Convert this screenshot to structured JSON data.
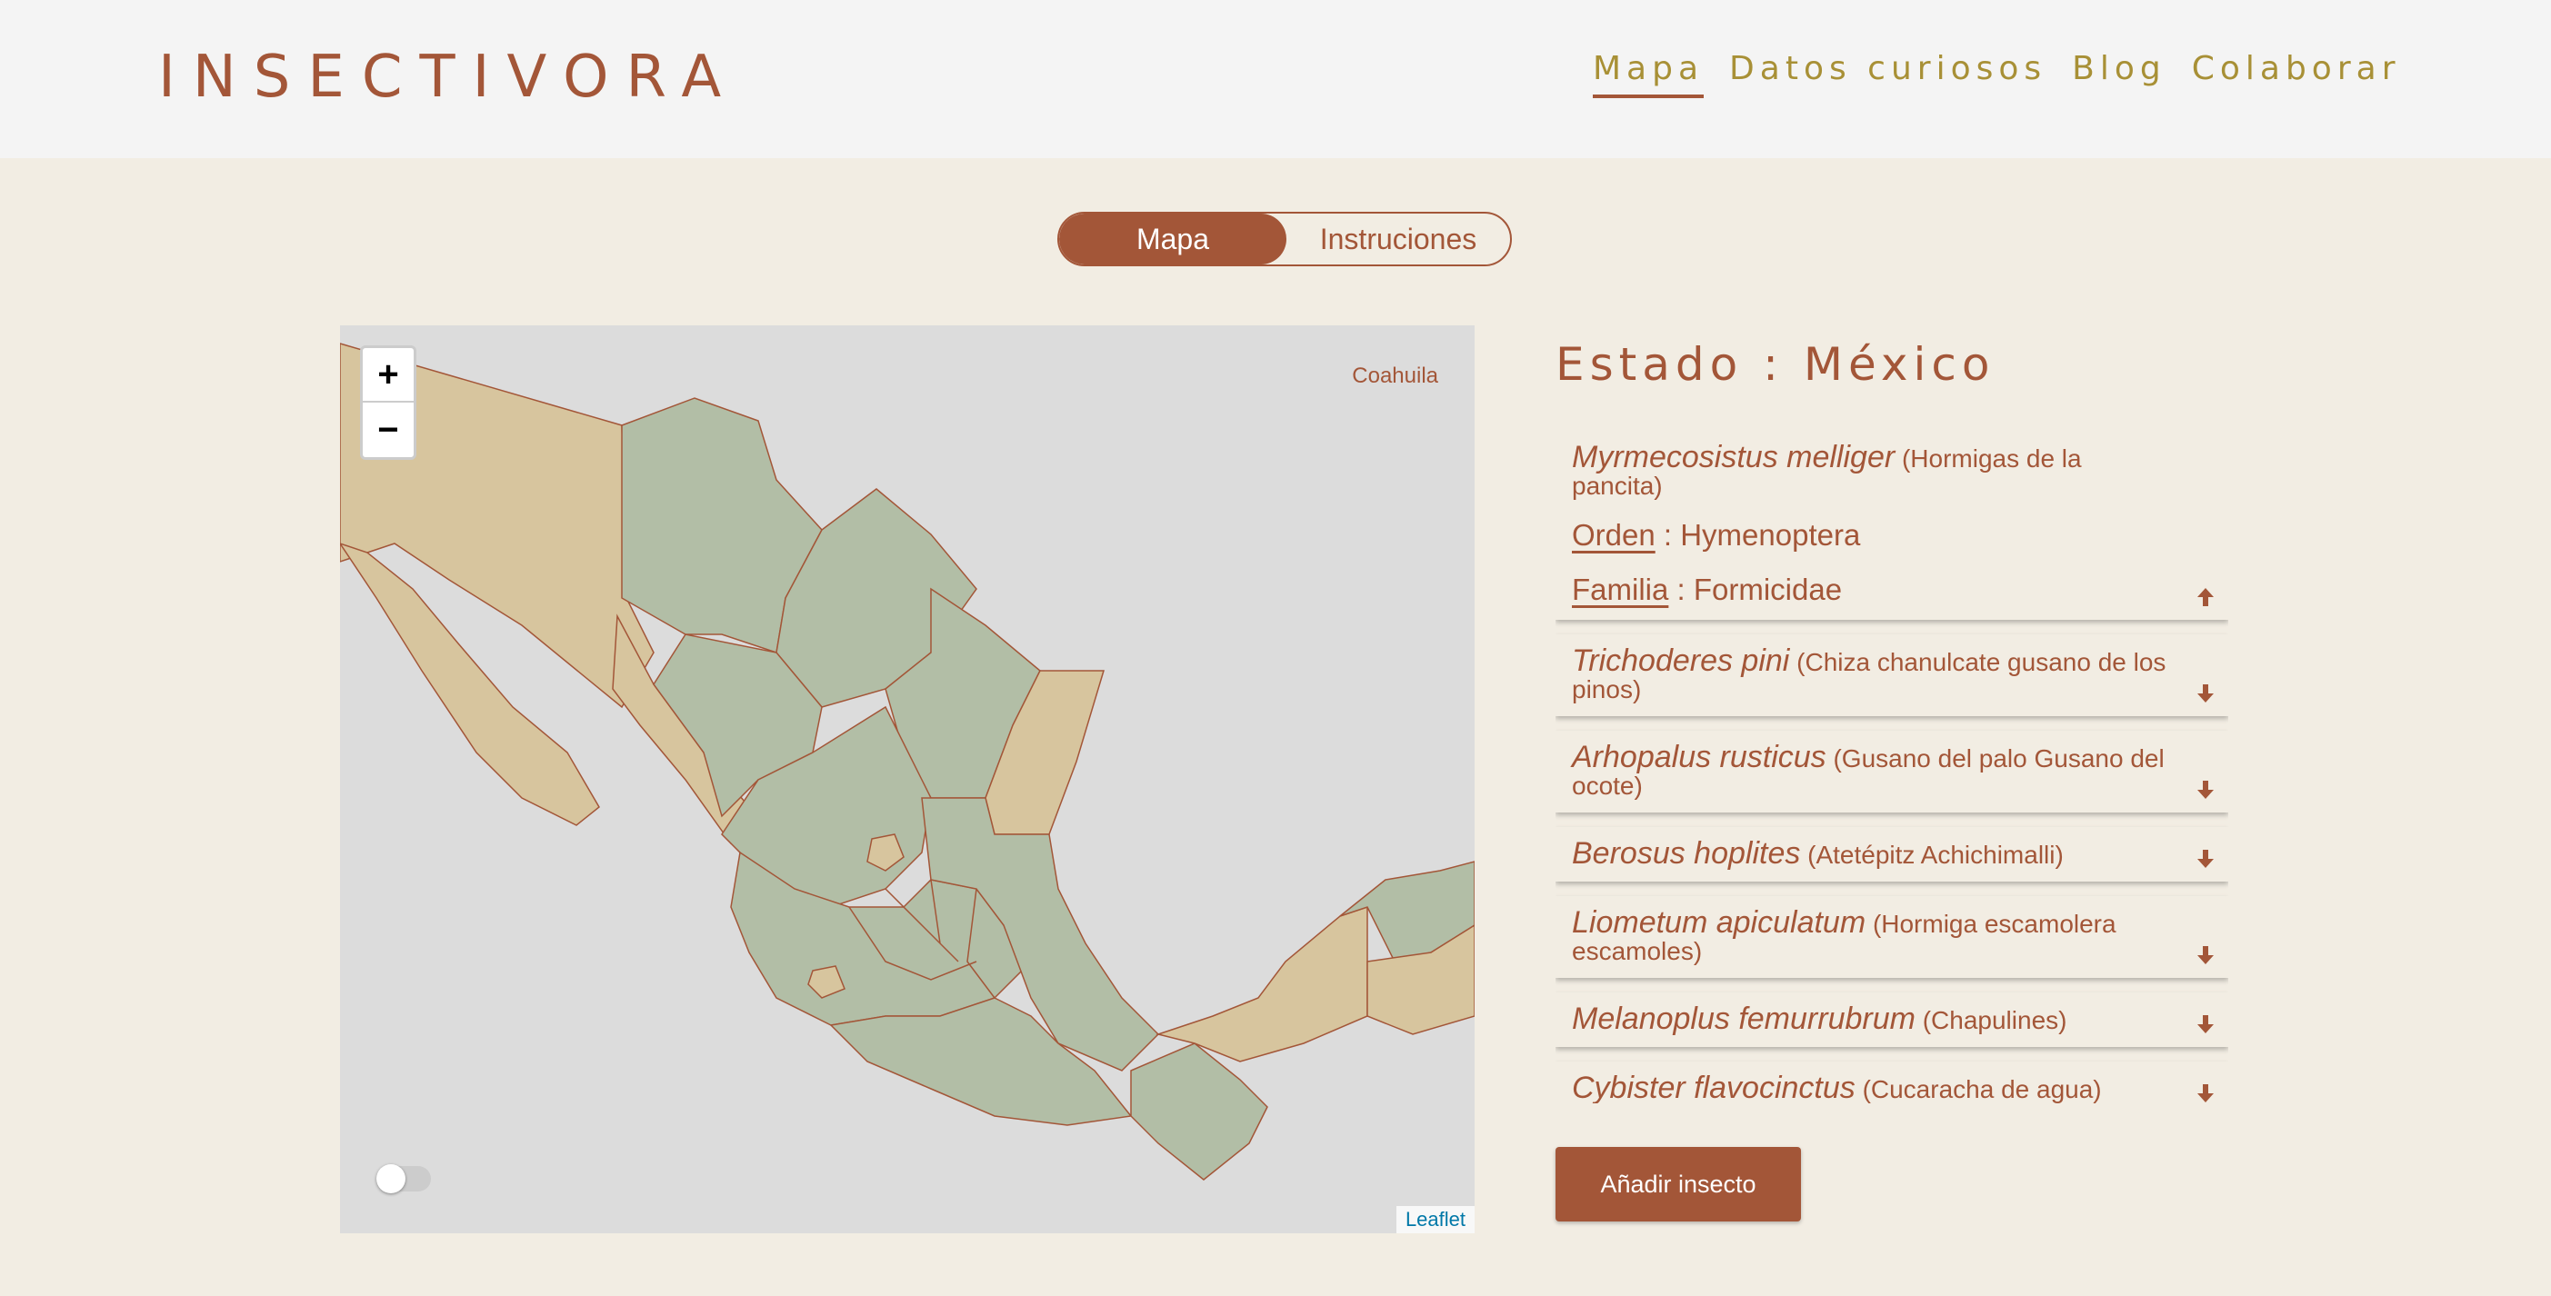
{
  "header": {
    "logo": "INSECTIVORA",
    "nav": [
      {
        "label": "Mapa",
        "active": true
      },
      {
        "label": "Datos curiosos"
      },
      {
        "label": "Blog"
      },
      {
        "label": "Colaborar"
      }
    ]
  },
  "view_toggle": {
    "map_label": "Mapa",
    "instructions_label": "Instruciones",
    "selected": "Mapa"
  },
  "map": {
    "zoom_in": "+",
    "zoom_out": "−",
    "hover_state": "Coahuila",
    "attribution": "Leaflet",
    "colors": {
      "water": "#dcdcdc",
      "with_records": "#b2bea6",
      "without_records": "#d7c59e",
      "border": "#a35638"
    },
    "toggle_on": false
  },
  "panel": {
    "state_title": "Estado : México",
    "insects": [
      {
        "scientific": "Myrmecosistus melliger",
        "common": "(Hormigas de la pancita)",
        "expanded": true,
        "order_label": "Orden",
        "order_value": " : Hymenoptera",
        "family_label": "Familia",
        "family_value": " : Formicidae",
        "arrow": "arrow-up-icon"
      },
      {
        "scientific": "Trichoderes pini",
        "common": "(Chiza chanulcate gusano de los pinos)",
        "arrow": "arrow-down-icon"
      },
      {
        "scientific": "Arhopalus rusticus",
        "common": "(Gusano del palo Gusano del ocote)",
        "arrow": "arrow-down-icon"
      },
      {
        "scientific": "Berosus hoplites",
        "common": "(Atetépitz Achichimalli)",
        "arrow": "arrow-down-icon"
      },
      {
        "scientific": "Liometum apiculatum",
        "common": "(Hormiga escamolera escamoles)",
        "arrow": "arrow-down-icon"
      },
      {
        "scientific": "Melanoplus femurrubrum",
        "common": "(Chapulines)",
        "arrow": "arrow-down-icon"
      },
      {
        "scientific": "Cybister flavocinctus",
        "common": "(Cucaracha de agua)",
        "arrow": "arrow-down-icon"
      }
    ],
    "add_button": "Añadir insecto"
  },
  "colors": {
    "accent": "#a35638",
    "nav": "#a89036",
    "background": "#f2ede3",
    "header": "#f4f4f4"
  }
}
